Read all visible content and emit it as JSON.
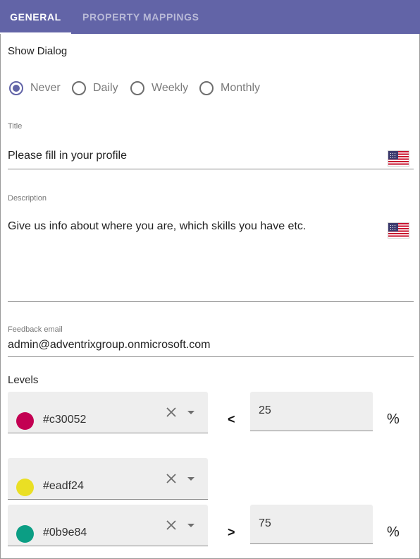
{
  "tabs": [
    {
      "label": "GENERAL",
      "active": true
    },
    {
      "label": "PROPERTY MAPPINGS",
      "active": false
    }
  ],
  "show_dialog": {
    "label": "Show Dialog",
    "options": [
      "Never",
      "Daily",
      "Weekly",
      "Monthly"
    ],
    "selected": "Never"
  },
  "title_field": {
    "label": "Title",
    "value": "Please fill in your profile",
    "language_flag": "us-flag-icon"
  },
  "description_field": {
    "label": "Description",
    "value": "Give us info about where you are, which skills you have etc.",
    "language_flag": "us-flag-icon"
  },
  "feedback_email": {
    "label": "Feedback email",
    "value": "admin@adventrixgroup.onmicrosoft.com"
  },
  "levels": {
    "label": "Levels",
    "items": [
      {
        "color": "#c30052",
        "operator": "<",
        "threshold": "25",
        "unit": "%"
      },
      {
        "color": "#eadf24",
        "operator": "",
        "threshold": "",
        "unit": ""
      },
      {
        "color": "#0b9e84",
        "operator": ">",
        "threshold": "75",
        "unit": "%"
      }
    ]
  },
  "colors": {
    "accent": "#6264a7",
    "tab_bar": "#6264a7"
  }
}
